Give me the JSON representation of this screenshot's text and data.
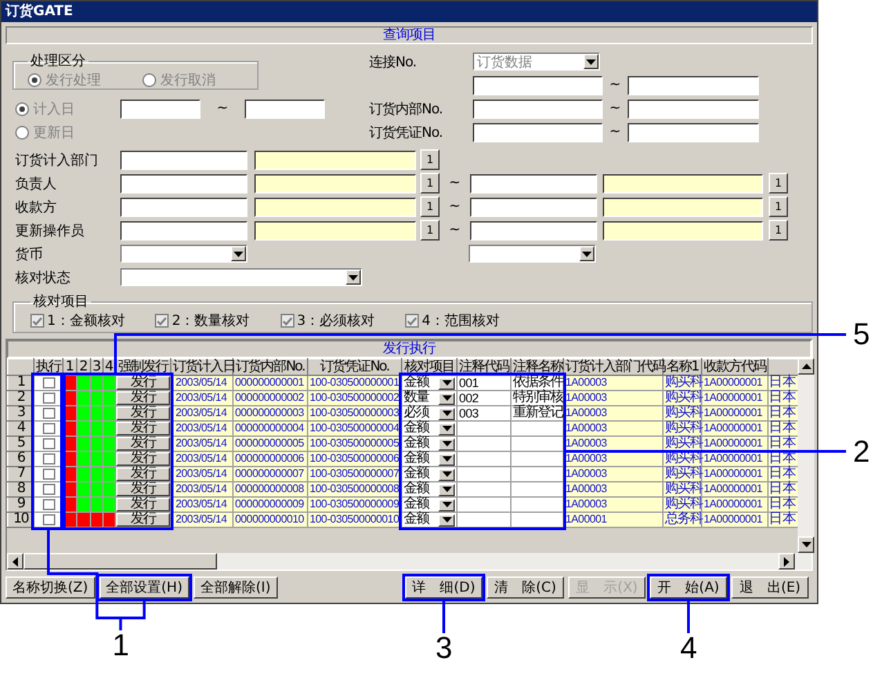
{
  "window": {
    "title": "订货GATE"
  },
  "query": {
    "header": "查询项目",
    "process_group": {
      "title": "处理区分",
      "options": [
        {
          "label": "发行处理",
          "selected": true
        },
        {
          "label": "发行取消",
          "selected": false
        }
      ]
    },
    "date_options": [
      {
        "label": "计入日",
        "selected": true
      },
      {
        "label": "更新日",
        "selected": false
      }
    ],
    "date_separator": "~",
    "right_rows": [
      {
        "kind": "dropdown",
        "label": "连接No.",
        "value": "订货数据"
      },
      {
        "kind": "range",
        "separator": "~"
      },
      {
        "kind": "range",
        "label": "订货内部No.",
        "separator": "~"
      },
      {
        "kind": "range",
        "label": "订货凭证No.",
        "separator": "~"
      }
    ],
    "lookup_rows": [
      {
        "label": "订货计入部门",
        "buttons": [
          "1"
        ]
      },
      {
        "label": "负责人",
        "separator": "~",
        "buttons": [
          "1",
          "1"
        ]
      },
      {
        "label": "收款方",
        "separator": "~",
        "buttons": [
          "1",
          "1"
        ]
      },
      {
        "label": "更新操作员",
        "separator": "~",
        "buttons": [
          "1",
          "1"
        ]
      }
    ],
    "dropdown_rows": [
      {
        "label": "货币",
        "kind": "pair"
      },
      {
        "label": "核对状态",
        "kind": "wide"
      }
    ],
    "check_group": {
      "title": "核对项目",
      "items": [
        {
          "label": "1：金额核对",
          "checked": true
        },
        {
          "label": "2：数量核对",
          "checked": true
        },
        {
          "label": "3：必须核对",
          "checked": true
        },
        {
          "label": "4：范围核对",
          "checked": true
        }
      ]
    }
  },
  "grid": {
    "header": "发行执行",
    "columns": [
      "执行",
      "1",
      "2",
      "3",
      "4",
      "强制发行",
      "订货计入日",
      "订货内部No.",
      "订货凭证No.",
      "核对项目",
      "注释代码",
      "注释名称",
      "订货计入部门代码",
      "名称1",
      "收款方代码"
    ],
    "rows": [
      {
        "number": "1",
        "execute": false,
        "passed": [
          false,
          true,
          true,
          true
        ],
        "action": "发行",
        "date": "2003/05/14",
        "internal_no": "000000000001",
        "voucher_no": "100-030500000001",
        "check_item": "金额",
        "note_code": "001",
        "note_name": "依据条件",
        "dept_code": "1A00003",
        "name1": "购买科",
        "payee_code": "1A00000001",
        "column_17": "日本"
      },
      {
        "number": "2",
        "execute": false,
        "passed": [
          false,
          true,
          true,
          true
        ],
        "action": "发行",
        "date": "2003/05/14",
        "internal_no": "000000000002",
        "voucher_no": "100-030500000002",
        "check_item": "数量",
        "note_code": "002",
        "note_name": "特别审核",
        "dept_code": "1A00003",
        "name1": "购买科",
        "payee_code": "1A00000001",
        "column_17": "日本"
      },
      {
        "number": "3",
        "execute": false,
        "passed": [
          false,
          true,
          true,
          true
        ],
        "action": "发行",
        "date": "2003/05/14",
        "internal_no": "000000000003",
        "voucher_no": "100-030500000003",
        "check_item": "必须",
        "note_code": "003",
        "note_name": "重新登记",
        "dept_code": "1A00003",
        "name1": "购买科",
        "payee_code": "1A00000001",
        "column_17": "日本"
      },
      {
        "number": "4",
        "execute": false,
        "passed": [
          false,
          true,
          true,
          true
        ],
        "action": "发行",
        "date": "2003/05/14",
        "internal_no": "000000000004",
        "voucher_no": "100-030500000004",
        "check_item": "金额",
        "dept_code": "1A00003",
        "name1": "购买科",
        "payee_code": "1A00000001",
        "column_17": "日本"
      },
      {
        "number": "5",
        "execute": false,
        "passed": [
          false,
          true,
          true,
          true
        ],
        "action": "发行",
        "date": "2003/05/14",
        "internal_no": "000000000005",
        "voucher_no": "100-030500000005",
        "check_item": "金额",
        "dept_code": "1A00003",
        "name1": "购买科",
        "payee_code": "1A00000001",
        "column_17": "日本"
      },
      {
        "number": "6",
        "execute": false,
        "passed": [
          false,
          true,
          true,
          true
        ],
        "action": "发行",
        "date": "2003/05/14",
        "internal_no": "000000000006",
        "voucher_no": "100-030500000006",
        "check_item": "金额",
        "dept_code": "1A00003",
        "name1": "购买科",
        "payee_code": "1A00000001",
        "column_17": "日本"
      },
      {
        "number": "7",
        "execute": false,
        "passed": [
          false,
          true,
          true,
          true
        ],
        "action": "发行",
        "date": "2003/05/14",
        "internal_no": "000000000007",
        "voucher_no": "100-030500000007",
        "check_item": "金额",
        "dept_code": "1A00003",
        "name1": "购买科",
        "payee_code": "1A00000001",
        "column_17": "日本"
      },
      {
        "number": "8",
        "execute": false,
        "passed": [
          false,
          true,
          true,
          true
        ],
        "action": "发行",
        "date": "2003/05/14",
        "internal_no": "000000000008",
        "voucher_no": "100-030500000008",
        "check_item": "金额",
        "dept_code": "1A00003",
        "name1": "购买科",
        "payee_code": "1A00000001",
        "column_17": "日本"
      },
      {
        "number": "9",
        "execute": false,
        "passed": [
          false,
          true,
          true,
          true
        ],
        "action": "发行",
        "date": "2003/05/14",
        "internal_no": "000000000009",
        "voucher_no": "100-030500000009",
        "check_item": "金额",
        "dept_code": "1A00003",
        "name1": "购买科",
        "payee_code": "1A00000001",
        "column_17": "日本"
      },
      {
        "number": "10",
        "execute": false,
        "passed": [
          false,
          false,
          false,
          false
        ],
        "action": "发行",
        "date": "2003/05/14",
        "internal_no": "000000000010",
        "voucher_no": "100-030500000010",
        "check_item": "金额",
        "dept_code": "1A00001",
        "name1": "总务科",
        "payee_code": "1A00000001",
        "column_17": "日本"
      }
    ]
  },
  "buttons_left": [
    {
      "label": "名称切换(Z)",
      "disabled": false
    },
    {
      "label": "全部设置(H)",
      "disabled": false
    },
    {
      "label": "全部解除(I)",
      "disabled": false
    }
  ],
  "buttons_right": [
    {
      "label": "详　细(D)",
      "disabled": false
    },
    {
      "label": "清　除(C)",
      "disabled": false
    },
    {
      "label": "显　示(X)",
      "disabled": true
    },
    {
      "label": "开　始(A)",
      "disabled": false
    },
    {
      "label": "退　出(E)",
      "disabled": false
    }
  ],
  "callouts": [
    {
      "label": "5"
    },
    {
      "label": "2"
    },
    {
      "label": "1"
    },
    {
      "label": "3"
    },
    {
      "label": "4"
    }
  ]
}
